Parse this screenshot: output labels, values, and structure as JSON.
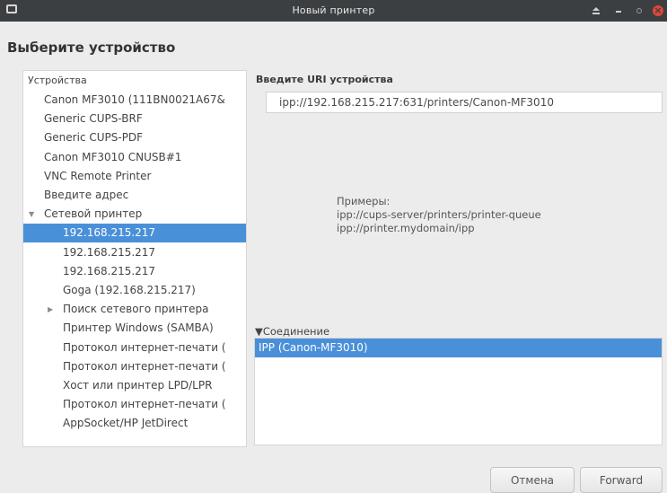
{
  "window": {
    "title": "Новый принтер",
    "controls": [
      "eject-icon",
      "minimize-icon",
      "restore-icon",
      "close-icon"
    ]
  },
  "heading": "Выберите устройство",
  "devices": {
    "header": "Устройства",
    "items": [
      {
        "label": "Canon MF3010 (111BN0021A67&",
        "level": 0
      },
      {
        "label": "Generic CUPS-BRF",
        "level": 0
      },
      {
        "label": "Generic CUPS-PDF",
        "level": 0
      },
      {
        "label": "Canon MF3010 CNUSB#1",
        "level": 0
      },
      {
        "label": "VNC Remote Printer",
        "level": 0
      },
      {
        "label": "Введите адрес",
        "level": 0
      },
      {
        "label": "Сетевой принтер",
        "level": 0,
        "expanded": true
      },
      {
        "label": "192.168.215.217",
        "level": 1,
        "selected": true
      },
      {
        "label": "192.168.215.217",
        "level": 1
      },
      {
        "label": "192.168.215.217",
        "level": 1
      },
      {
        "label": "Goga (192.168.215.217)",
        "level": 1
      },
      {
        "label": "Поиск сетевого принтера",
        "level": 1,
        "collapsed": true
      },
      {
        "label": "Принтер Windows (SAMBA)",
        "level": 1
      },
      {
        "label": "Протокол интернет-печати (",
        "level": 1
      },
      {
        "label": "Протокол интернет-печати (",
        "level": 1
      },
      {
        "label": "Хост или принтер LPD/LPR",
        "level": 1
      },
      {
        "label": "Протокол интернет-печати (",
        "level": 1
      },
      {
        "label": "AppSocket/HP JetDirect",
        "level": 1
      }
    ]
  },
  "uri": {
    "label": "Введите URI устройства",
    "value": "ipp://192.168.215.217:631/printers/Canon-MF3010"
  },
  "examples": {
    "title": "Примеры:",
    "lines": [
      "ipp://cups-server/printers/printer-queue",
      "ipp://printer.mydomain/ipp"
    ]
  },
  "connection": {
    "header": "Соединение",
    "items": [
      "IPP (Canon-MF3010)"
    ]
  },
  "buttons": {
    "cancel": "Отмена",
    "forward": "Forward"
  },
  "colors": {
    "selection": "#4a90d9",
    "titlebar": "#3c3f41",
    "close": "#e0463a"
  }
}
